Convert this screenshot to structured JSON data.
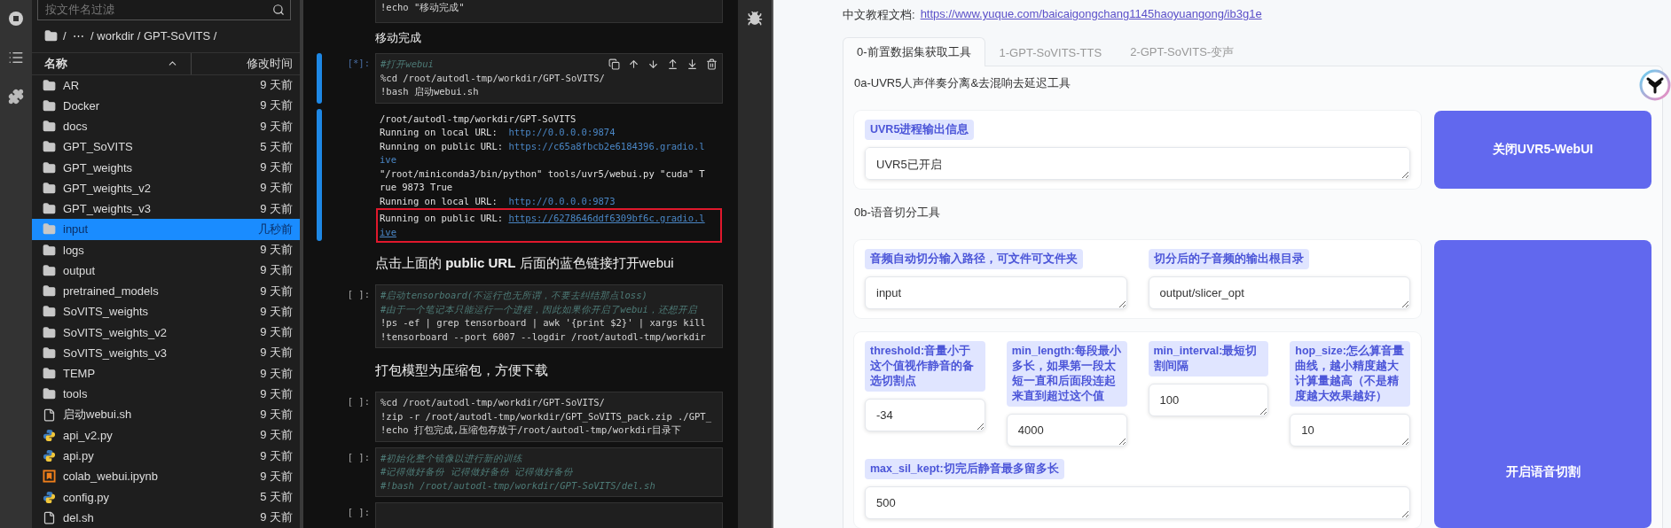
{
  "file_browser": {
    "filter": {
      "placeholder": "按文件名过滤"
    },
    "breadcrumb": "/  ⋯  / workdir / GPT-SoVITS /",
    "columns": [
      "名称",
      "修改时间"
    ],
    "files": [
      {
        "name": "AR",
        "kind": "folder",
        "modified": "9 天前",
        "selected": false
      },
      {
        "name": "Docker",
        "kind": "folder",
        "modified": "9 天前",
        "selected": false
      },
      {
        "name": "docs",
        "kind": "folder",
        "modified": "9 天前",
        "selected": false
      },
      {
        "name": "GPT_SoVITS",
        "kind": "folder",
        "modified": "5 天前",
        "selected": false
      },
      {
        "name": "GPT_weights",
        "kind": "folder",
        "modified": "9 天前",
        "selected": false
      },
      {
        "name": "GPT_weights_v2",
        "kind": "folder",
        "modified": "9 天前",
        "selected": false
      },
      {
        "name": "GPT_weights_v3",
        "kind": "folder",
        "modified": "9 天前",
        "selected": false
      },
      {
        "name": "input",
        "kind": "folder",
        "modified": "几秒前",
        "selected": true
      },
      {
        "name": "logs",
        "kind": "folder",
        "modified": "9 天前",
        "selected": false
      },
      {
        "name": "output",
        "kind": "folder",
        "modified": "9 天前",
        "selected": false
      },
      {
        "name": "pretrained_models",
        "kind": "folder",
        "modified": "9 天前",
        "selected": false
      },
      {
        "name": "SoVITS_weights",
        "kind": "folder",
        "modified": "9 天前",
        "selected": false
      },
      {
        "name": "SoVITS_weights_v2",
        "kind": "folder",
        "modified": "9 天前",
        "selected": false
      },
      {
        "name": "SoVITS_weights_v3",
        "kind": "folder",
        "modified": "9 天前",
        "selected": false
      },
      {
        "name": "TEMP",
        "kind": "folder",
        "modified": "9 天前",
        "selected": false
      },
      {
        "name": "tools",
        "kind": "folder",
        "modified": "9 天前",
        "selected": false
      },
      {
        "name": "启动webui.sh",
        "kind": "file",
        "modified": "9 天前",
        "selected": false
      },
      {
        "name": "api_v2.py",
        "kind": "python",
        "modified": "9 天前",
        "selected": false
      },
      {
        "name": "api.py",
        "kind": "python",
        "modified": "9 天前",
        "selected": false
      },
      {
        "name": "colab_webui.ipynb",
        "kind": "notebook",
        "modified": "9 天前",
        "selected": false
      },
      {
        "name": "config.py",
        "kind": "python",
        "modified": "5 天前",
        "selected": false
      },
      {
        "name": "del.sh",
        "kind": "file",
        "modified": "9 天前",
        "selected": false
      }
    ]
  },
  "notebook": {
    "cells": [
      {
        "kind": "code",
        "selected": false,
        "lines": [
          {
            "kind": "code",
            "text": "!echo \"移动完成\""
          }
        ]
      },
      {
        "kind": "markdown",
        "selected": false,
        "text": "移动完成"
      },
      {
        "kind": "code",
        "prompt": "[*]:",
        "selected": true,
        "lines": [
          {
            "kind": "comment",
            "text": "#打开webui"
          },
          {
            "kind": "code",
            "text": "%cd /root/autodl-tmp/workdir/GPT-SoVITS/"
          },
          {
            "kind": "code",
            "text": "!bash 启动webui.sh"
          }
        ],
        "output": [
          {
            "lines": [
              {
                "text": "/root/autodl-tmp/workdir/GPT-SoVITS"
              },
              {
                "text": "Running on local URL:  ",
                "link": "http://0.0.0.0:9874"
              },
              {
                "text": "Running on public URL: ",
                "link": "https://c65a8fbcb2e6184396.gradio.l"
              },
              {
                "link": "ive"
              },
              {
                "text": "\"/root/miniconda3/bin/python\" tools/uvr5/webui.py \"cuda\" T"
              },
              {
                "text": "rue 9873 True"
              },
              {
                "text": "Running on local URL:  ",
                "link": "http://0.0.0.0:9873"
              }
            ]
          },
          {
            "highlighted": true,
            "lines": [
              {
                "text": "Running on public URL: ",
                "link": "https://6278646ddf6309bf6c.gradio.l"
              },
              {
                "link": "ive"
              }
            ]
          }
        ]
      },
      {
        "kind": "markdown",
        "selected": false,
        "text": "点击上面的 **public URL** 后面的蓝色链接打开webui"
      },
      {
        "kind": "code",
        "prompt": "[ ]:",
        "selected": false,
        "lines": [
          {
            "kind": "comment",
            "text": "#启动tensorboard(不运行也无所谓，不要去纠结那点loss)"
          },
          {
            "kind": "comment",
            "text": "#由于一个笔记本只能运行一个进程，因此如果你开启了webui，还想开启"
          },
          {
            "kind": "code",
            "text": "!ps -ef | grep tensorboard | awk '{print $2}' | xargs kill"
          },
          {
            "kind": "code",
            "text": "!tensorboard --port 6007 --logdir /root/autodl-tmp/workdir"
          }
        ]
      },
      {
        "kind": "markdown",
        "selected": false,
        "text": "打包模型为压缩包，方便下载"
      },
      {
        "kind": "code",
        "prompt": "[ ]:",
        "selected": false,
        "lines": [
          {
            "kind": "code",
            "text": "%cd /root/autodl-tmp/workdir/GPT-SoVITS/"
          },
          {
            "kind": "code",
            "text": "!zip -r /root/autodl-tmp/workdir/GPT_SoVITS_pack.zip ./GPT_"
          },
          {
            "kind": "code",
            "text": "!echo 打包完成,压缩包存放于/root/autodl-tmp/workdir目录下"
          }
        ]
      },
      {
        "kind": "code",
        "prompt": "[ ]:",
        "selected": false,
        "lines": [
          {
            "kind": "comment",
            "text": "#初始化整个镜像以进行新的训练"
          },
          {
            "kind": "comment",
            "text": "#记得做好备份 记得做好备份 记得做好备份"
          },
          {
            "kind": "comment",
            "text": "#!bash /root/autodl-tmp/workdir/GPT-SoVITS/del.sh"
          }
        ]
      },
      {
        "kind": "code",
        "prompt": "[ ]:",
        "selected": false
      }
    ]
  },
  "web": {
    "tutorial": {
      "label": "中文教程文档:",
      "link": "https://www.yuque.com/baicaigongchang1145haoyuangong/ib3g1e"
    },
    "tabs": [
      {
        "label": "0-前置数据集获取工具",
        "selected": true
      },
      {
        "label": "1-GPT-SoVITS-TTS",
        "selected": false
      },
      {
        "label": "2-GPT-SoVITS-变声",
        "selected": false
      }
    ],
    "sections": [
      {
        "title": "0a-UVR5人声伴奏分离&去混响去延迟工具",
        "button": "关闭UVR5-WebUI",
        "groups": [
          {
            "fields": [
              {
                "kind": "full",
                "label": "UVR5进程输出信息",
                "value": "UVR5已开启"
              }
            ]
          }
        ]
      },
      {
        "title": "0b-语音切分工具",
        "button": "开启语音切割",
        "groups": [
          {
            "fields": [
              {
                "kind": "half",
                "label": "音频自动切分输入路径，可文件可文件夹",
                "value": "input"
              },
              {
                "kind": "half",
                "label": "切分后的子音频的输出根目录",
                "value": "output/slicer_opt"
              }
            ]
          },
          {
            "fields": [
              {
                "kind": "quarter",
                "label": "threshold:音量小于这个值视作静音的备选切割点",
                "value": "-34"
              },
              {
                "kind": "quarter",
                "label": "min_length:每段最小多长，如果第一段太短一直和后面段连起来直到超过这个值",
                "value": "4000"
              },
              {
                "kind": "quarter",
                "label": "min_interval:最短切割间隔",
                "value": "100"
              },
              {
                "kind": "quarter",
                "label": "hop_size:怎么算音量曲线，越小精度越大计算量越高（不是精度越大效果越好）",
                "value": "10"
              },
              {
                "kind": "full",
                "label": "max_sil_kept:切完后静音最多留多长",
                "value": "500"
              }
            ]
          }
        ]
      }
    ]
  }
}
